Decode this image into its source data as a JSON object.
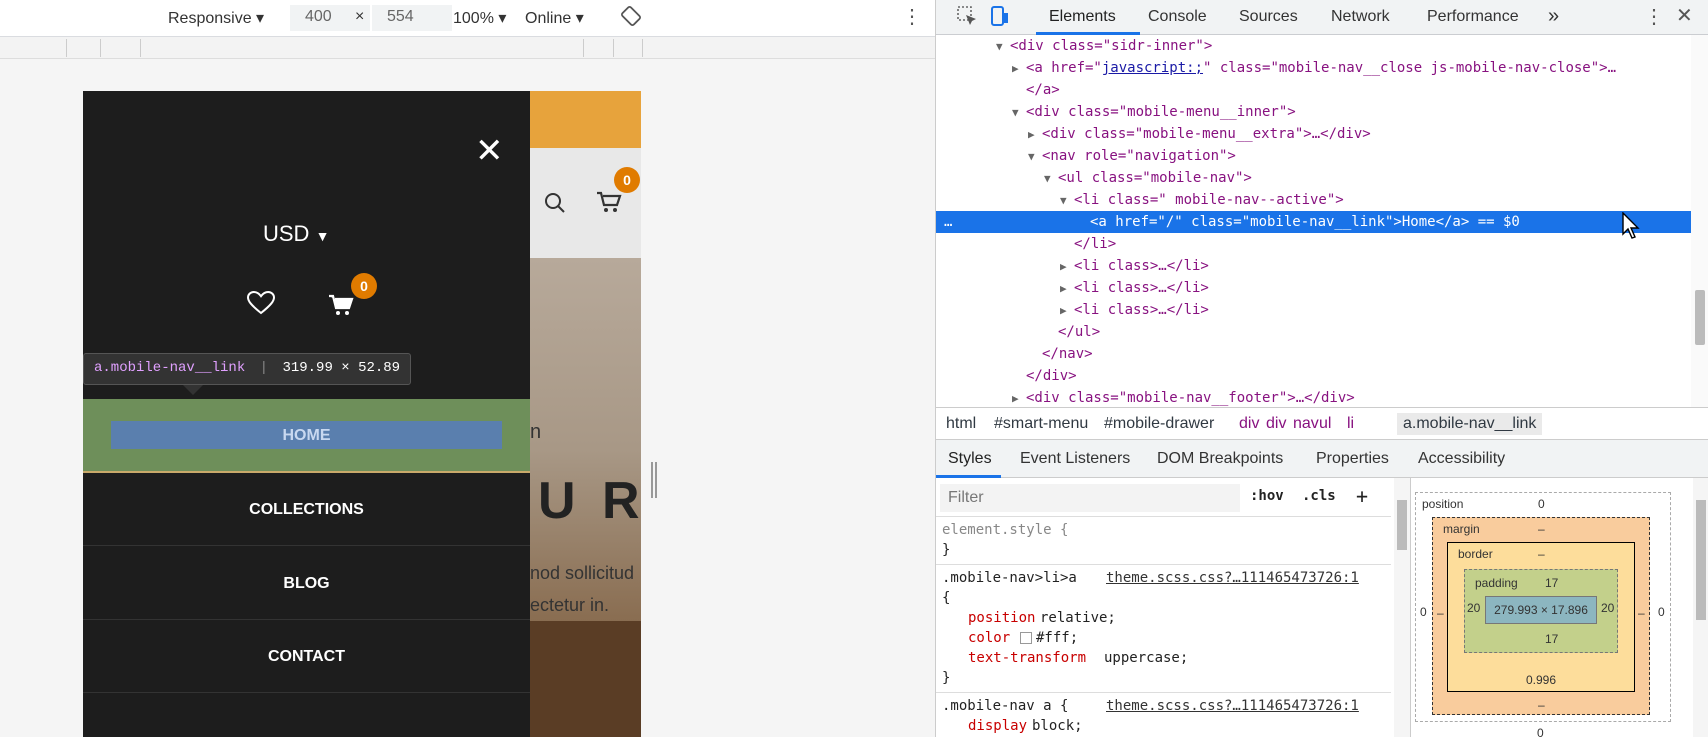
{
  "device_toolbar": {
    "device": "Responsive",
    "width": "400",
    "times": "×",
    "height": "554",
    "zoom": "100%",
    "network": "Online"
  },
  "site": {
    "cart_count": "0",
    "hero_text_1": "n",
    "hero_text_2": "U R",
    "hero_text_3": "nod sollicitud",
    "hero_text_4": "ectetur in."
  },
  "drawer": {
    "currency": "USD",
    "cart_count": "0",
    "nav": [
      "HOME",
      "COLLECTIONS",
      "BLOG",
      "CONTACT"
    ]
  },
  "tooltip": {
    "selector": "a.mobile-nav__link",
    "size": "319.99 × 52.89"
  },
  "devtools": {
    "tabs": [
      "Elements",
      "Console",
      "Sources",
      "Network",
      "Performance",
      "»"
    ],
    "dom": [
      {
        "depth": 0,
        "tri": "▼",
        "html": "<div class=\"sidr-inner\">"
      },
      {
        "depth": 1,
        "tri": "▶",
        "pre": "<a href=\"",
        "link": "javascript:;",
        "post": "\" class=\"mobile-nav__close js-mobile-nav-close\">…"
      },
      {
        "depth": 1,
        "tri": "",
        "html": "</a>"
      },
      {
        "depth": 1,
        "tri": "▼",
        "html": "<div class=\"mobile-menu__inner\">"
      },
      {
        "depth": 2,
        "tri": "▶",
        "html": "<div class=\"mobile-menu__extra\">…</div>"
      },
      {
        "depth": 2,
        "tri": "▼",
        "html": "<nav role=\"navigation\">"
      },
      {
        "depth": 3,
        "tri": "▼",
        "html": "<ul class=\"mobile-nav\">"
      },
      {
        "depth": 4,
        "tri": "▼",
        "html": "<li class=\" mobile-nav--active\">"
      },
      {
        "depth": 5,
        "tri": "",
        "html": "<a href=\"/\" class=\"mobile-nav__link\">Home</a> == $0",
        "selected": true
      },
      {
        "depth": 4,
        "tri": "",
        "html": "</li>"
      },
      {
        "depth": 4,
        "tri": "▶",
        "html": "<li class>…</li>"
      },
      {
        "depth": 4,
        "tri": "▶",
        "html": "<li class>…</li>"
      },
      {
        "depth": 4,
        "tri": "▶",
        "html": "<li class>…</li>"
      },
      {
        "depth": 3,
        "tri": "",
        "html": "</ul>"
      },
      {
        "depth": 2,
        "tri": "",
        "html": "</nav>"
      },
      {
        "depth": 1,
        "tri": "",
        "html": "</div>"
      },
      {
        "depth": 1,
        "tri": "▶",
        "html": "<div class=\"mobile-nav__footer\">…</div>"
      }
    ],
    "breadcrumb": [
      "html",
      "#smart-menu",
      "#mobile-drawer",
      "div",
      "div",
      "nav",
      "ul",
      "li",
      "a.mobile-nav__link"
    ],
    "sub_tabs": [
      "Styles",
      "Event Listeners",
      "DOM Breakpoints",
      "Properties",
      "Accessibility"
    ],
    "filter_placeholder": "Filter",
    "hov": ":hov",
    "cls": ".cls",
    "plus": "+",
    "element_style": "element.style {",
    "close_brace": "}",
    "rule1": {
      "selector": ".mobile-nav>li>a",
      "source": "theme.scss.css?…111465473726:1",
      "open": "{",
      "props": [
        [
          "position",
          "relative;"
        ],
        [
          "color",
          "#fff;"
        ],
        [
          "text-transform",
          "uppercase;"
        ]
      ]
    },
    "rule2": {
      "selector": ".mobile-nav a {",
      "source": "theme.scss.css?…111465473726:1",
      "props": [
        [
          "display",
          "block;"
        ]
      ]
    },
    "box": {
      "position_label": "position",
      "position": "0",
      "margin_label": "margin",
      "margin": "–",
      "border_label": "border",
      "border": "–",
      "padding_label": "padding",
      "padding_top": "17",
      "padding_bottom": "17",
      "padding_left": "20",
      "padding_right": "20",
      "content": "279.993 × 17.896",
      "border_bottom": "0.996",
      "margin_bottom": "–",
      "outer_left": "0",
      "outer_right": "0",
      "dash": "–",
      "below": "0"
    }
  }
}
